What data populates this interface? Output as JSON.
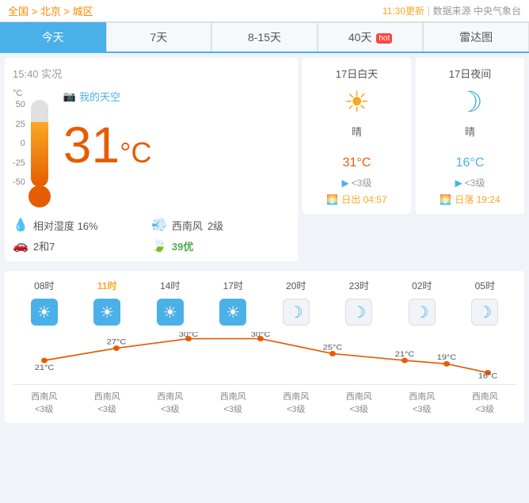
{
  "topBar": {
    "breadcrumb": "全国 > 北京 > 城区",
    "updateTime": "11:30更新",
    "separator": " | ",
    "dataSource": "数据来源 中央气象台"
  },
  "tabs": [
    {
      "id": "today",
      "label": "今天",
      "active": true
    },
    {
      "id": "7day",
      "label": "7天",
      "active": false
    },
    {
      "id": "8-15day",
      "label": "8-15天",
      "active": false
    },
    {
      "id": "40day",
      "label": "40天",
      "active": false,
      "badge": "hot"
    },
    {
      "id": "radar",
      "label": "雷达图",
      "active": false
    }
  ],
  "observation": {
    "time": "15:40 实况",
    "temperature": "31",
    "tempUnit": "°C",
    "skyLink": "我的天空",
    "humidity": {
      "label": "相对湿度",
      "value": "16%"
    },
    "wind": {
      "label": "西南风",
      "level": "2级"
    },
    "carRestrict": {
      "label": "2和7"
    },
    "aqi": {
      "label": "39优"
    }
  },
  "thermometer": {
    "scaleLabels": [
      "50",
      "25",
      "0",
      "-25",
      "-50"
    ],
    "celsius": "°C"
  },
  "todayForecast": {
    "daytime": {
      "label": "17日白天",
      "weather": "晴",
      "temp": "31",
      "tempUnit": "°C",
      "windDir": "<3级",
      "sunrise": "日出 04:57"
    },
    "night": {
      "label": "17日夜间",
      "weather": "晴",
      "temp": "16",
      "tempUnit": "°C",
      "windDir": "<3级",
      "sunset": "日落 19:24"
    }
  },
  "hourly": {
    "times": [
      "08时",
      "11时",
      "14时",
      "17时",
      "20时",
      "23时",
      "02时",
      "05时"
    ],
    "timeHighlight": [
      false,
      true,
      false,
      false,
      false,
      false,
      false,
      false
    ],
    "icons": [
      "sun",
      "sun",
      "sun",
      "sun",
      "moon",
      "moon",
      "moon",
      "moon"
    ],
    "temps": [
      21,
      27,
      30,
      30,
      25,
      21,
      19,
      16
    ],
    "winds": [
      "西南风\n<3级",
      "西南风\n<3级",
      "西南风\n<3级",
      "西南风\n<3级",
      "西南风\n<3级",
      "西南风\n<3级",
      "西南风\n<3级",
      "西南风\n<3级"
    ]
  },
  "colors": {
    "accent": "#4ab0e8",
    "orange": "#e65c00",
    "gold": "#f9a825",
    "tabActive": "#4ab0e8",
    "good": "#4caf50"
  }
}
